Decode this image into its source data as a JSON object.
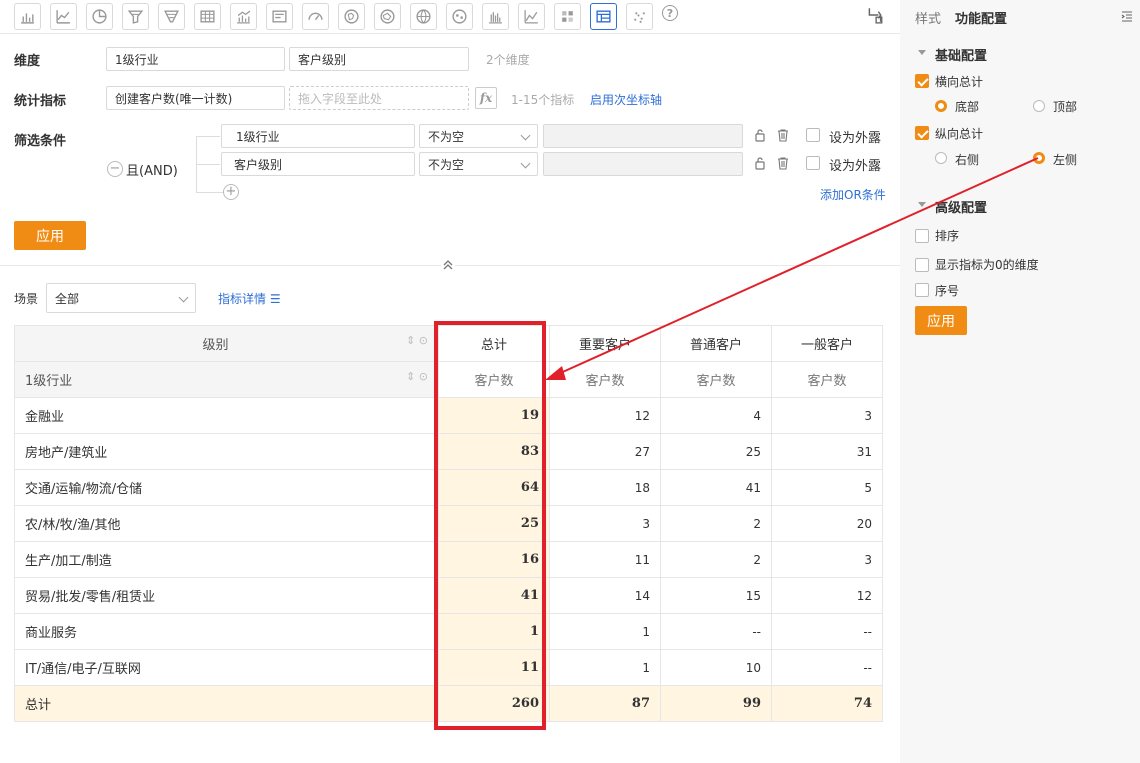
{
  "toolbar": {
    "icons": [
      "bar-chart-icon",
      "line-chart-icon",
      "pie-chart-icon",
      "funnel-icon",
      "funnel-alt-icon",
      "table-icon",
      "combo-chart-icon",
      "text-card-icon",
      "gauge-icon",
      "map-cn-icon",
      "map-cn-alt-icon",
      "world-map-icon",
      "area-map-icon",
      "histogram-icon",
      "area-chart-icon",
      "heatmap-icon",
      "pivot-table-icon",
      "scatter-icon"
    ],
    "help": "?"
  },
  "config": {
    "dimension_label": "维度",
    "dimension_1": "1级行业",
    "dimension_2": "客户级别",
    "dimension_hint": "2个维度",
    "metric_label": "统计指标",
    "metric_1": "创建客户数(唯一计数)",
    "metric_placeholder": "拖入字段至此处",
    "metric_hint": "1-15个指标",
    "secondary_axis_link": "启用次坐标轴",
    "filter_label": "筛选条件",
    "logic_label": "且(AND)",
    "filters": [
      {
        "field": "1级行业",
        "op": "不为空",
        "expose_label": "设为外露"
      },
      {
        "field": "客户级别",
        "op": "不为空",
        "expose_label": "设为外露"
      }
    ],
    "add_or_link": "添加OR条件",
    "apply_label": "应用"
  },
  "scene": {
    "label": "场景",
    "value": "全部",
    "detail_link": "指标详情"
  },
  "table": {
    "row_header": "级别",
    "row_sub_header": "1级行业",
    "columns": [
      "总计",
      "重要客户",
      "普通客户",
      "一般客户"
    ],
    "sub_header": "客户数",
    "rows": [
      {
        "name": "金融业",
        "values": [
          "19",
          "12",
          "4",
          "3"
        ]
      },
      {
        "name": "房地产/建筑业",
        "values": [
          "83",
          "27",
          "25",
          "31"
        ]
      },
      {
        "name": "交通/运输/物流/仓储",
        "values": [
          "64",
          "18",
          "41",
          "5"
        ]
      },
      {
        "name": "农/林/牧/渔/其他",
        "values": [
          "25",
          "3",
          "2",
          "20"
        ]
      },
      {
        "name": "生产/加工/制造",
        "values": [
          "16",
          "11",
          "2",
          "3"
        ]
      },
      {
        "name": "贸易/批发/零售/租赁业",
        "values": [
          "41",
          "14",
          "15",
          "12"
        ]
      },
      {
        "name": "商业服务",
        "values": [
          "1",
          "1",
          "--",
          "--"
        ]
      },
      {
        "name": "IT/通信/电子/互联网",
        "values": [
          "11",
          "1",
          "10",
          "--"
        ]
      }
    ],
    "grand_total": {
      "name": "总计",
      "values": [
        "260",
        "87",
        "99",
        "74"
      ]
    }
  },
  "panel": {
    "tab_style": "样式",
    "tab_function": "功能配置",
    "basic_title": "基础配置",
    "horizontal_total": "横向总计",
    "h_opt_bottom": "底部",
    "h_opt_top": "顶部",
    "vertical_total": "纵向总计",
    "v_opt_right": "右侧",
    "v_opt_left": "左侧",
    "advanced_title": "高级配置",
    "sort": "排序",
    "show_zero": "显示指标为0的维度",
    "serial": "序号",
    "apply_label": "应用"
  },
  "colors": {
    "accent": "#f08c14",
    "link": "#2f6fd6",
    "highlight": "#e0202a"
  }
}
